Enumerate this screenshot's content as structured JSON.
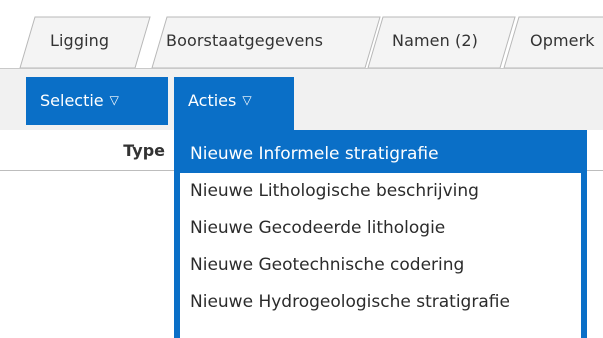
{
  "tabs": [
    {
      "label": "Ligging"
    },
    {
      "label": "Boorstaatgegevens"
    },
    {
      "label": "Namen (2)"
    },
    {
      "label": "Opmerk"
    }
  ],
  "toolbar": {
    "selectie_label": "Selectie",
    "acties_label": "Acties",
    "caret_glyph": "▽"
  },
  "table": {
    "type_header": "Type"
  },
  "acties_menu": {
    "highlighted_index": 0,
    "items": [
      {
        "label": "Nieuwe Informele stratigrafie"
      },
      {
        "label": "Nieuwe Lithologische beschrijving"
      },
      {
        "label": "Nieuwe Gecodeerde lithologie"
      },
      {
        "label": "Nieuwe Geotechnische codering"
      },
      {
        "label": "Nieuwe Hydrogeologische stratigrafie"
      }
    ]
  },
  "colors": {
    "accent": "#0a6fc7",
    "toolbar_bg": "#f1f1f1",
    "text": "#333333"
  }
}
